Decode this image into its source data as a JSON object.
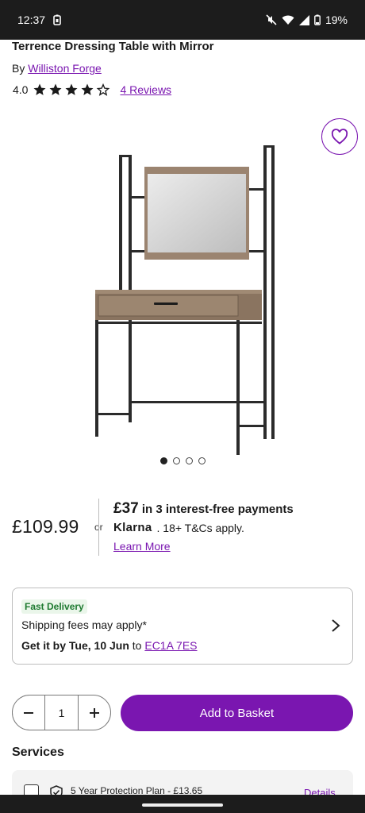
{
  "status_bar": {
    "time": "12:37",
    "battery": "19%"
  },
  "product": {
    "title": "Terrence Dressing Table with Mirror",
    "by_prefix": "By",
    "brand": "Williston Forge",
    "rating": "4.0",
    "rating_value": 4,
    "rating_max": 5,
    "reviews_link": "4 Reviews"
  },
  "gallery": {
    "image_count": 4,
    "active_index": 0
  },
  "pricing": {
    "price": "£109.99",
    "or": "or",
    "klarna_amount": "£37",
    "klarna_text": "in 3 interest-free payments",
    "klarna_logo": "Klarna",
    "klarna_terms": ". 18+ T&Cs apply.",
    "learn_more": "Learn More"
  },
  "delivery": {
    "badge": "Fast Delivery",
    "shipping": "Shipping fees may apply*",
    "get_it_prefix": "Get it by Tue, 10 Jun",
    "to": "to",
    "postcode": "EC1A 7ES"
  },
  "purchase": {
    "minus": "−",
    "quantity": "1",
    "plus": "+",
    "add_to_basket": "Add to Basket"
  },
  "services": {
    "heading": "Services",
    "plan_label": "5 Year Protection Plan - £13.65",
    "details": "Details"
  },
  "colors": {
    "accent": "#7a16b0",
    "badge_green": "#1e7a30",
    "badge_bg": "#eaf6ea"
  }
}
